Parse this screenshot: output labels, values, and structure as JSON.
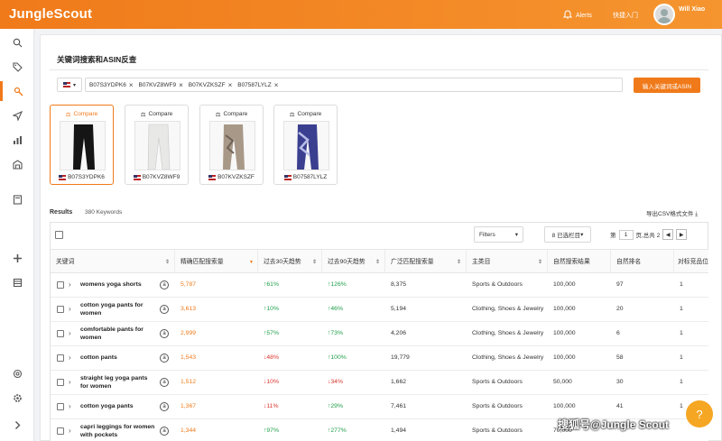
{
  "app": {
    "logo": "JungleScout"
  },
  "header": {
    "alerts": "Alerts",
    "quick_entry": "快捷入门",
    "username": "Will Xiao"
  },
  "section": {
    "title": "关键词搜索和ASIN反查"
  },
  "search": {
    "country": "US",
    "asins": [
      "B07S3YDPK6",
      "B07KVZ8WF9",
      "B07KVZKSZF",
      "B07587LYLZ"
    ],
    "button_label": "输入关键词或ASIN"
  },
  "products": [
    {
      "compare": "Compare",
      "asin": "B07S3YDPK6"
    },
    {
      "compare": "Compare",
      "asin": "B07KVZ8WF9"
    },
    {
      "compare": "Compare",
      "asin": "B07KVZKSZF"
    },
    {
      "compare": "Compare",
      "asin": "B07587LYLZ"
    }
  ],
  "results": {
    "label": "Results",
    "count": "380 Keywords",
    "export": "导出CSV格式文件"
  },
  "toolbar": {
    "filters": "Filters",
    "columns": "8 已选栏目",
    "page_prefix": "第",
    "page_value": "1",
    "page_suffix": "页,总共 2"
  },
  "table": {
    "headers": [
      "关键词",
      "精确匹配搜索量",
      "过去30天趋势",
      "过去90天趋势",
      "广泛匹配搜索量",
      "主类目",
      "自然搜索结果",
      "自然排名",
      "对标竞品位"
    ],
    "rows": [
      {
        "keyword": "womens yoga shorts",
        "exact": "5,787",
        "t30": "61%",
        "t30dir": "up",
        "t90": "126%",
        "t90dir": "up",
        "broad": "8,375",
        "category": "Sports & Outdoors",
        "organic_results": "100,000",
        "organic_rank": "97",
        "competitor": "1"
      },
      {
        "keyword": "cotton yoga pants for women",
        "exact": "3,613",
        "t30": "10%",
        "t30dir": "up",
        "t90": "46%",
        "t90dir": "up",
        "broad": "5,194",
        "category": "Clothing, Shoes & Jewelry",
        "organic_results": "100,000",
        "organic_rank": "20",
        "competitor": "1"
      },
      {
        "keyword": "comfortable pants for women",
        "exact": "2,999",
        "t30": "57%",
        "t30dir": "up",
        "t90": "73%",
        "t90dir": "up",
        "broad": "4,206",
        "category": "Clothing, Shoes & Jewelry",
        "organic_results": "100,000",
        "organic_rank": "6",
        "competitor": "1"
      },
      {
        "keyword": "cotton pants",
        "exact": "1,543",
        "t30": "48%",
        "t30dir": "down",
        "t90": "100%",
        "t90dir": "up",
        "broad": "19,779",
        "category": "Clothing, Shoes & Jewelry",
        "organic_results": "100,000",
        "organic_rank": "58",
        "competitor": "1"
      },
      {
        "keyword": "straight leg yoga pants for women",
        "exact": "1,512",
        "t30": "10%",
        "t30dir": "down",
        "t90": "34%",
        "t90dir": "down",
        "broad": "1,662",
        "category": "Sports & Outdoors",
        "organic_results": "50,000",
        "organic_rank": "30",
        "competitor": "1"
      },
      {
        "keyword": "cotton yoga pants",
        "exact": "1,367",
        "t30": "11%",
        "t30dir": "down",
        "t90": "29%",
        "t90dir": "up",
        "broad": "7,461",
        "category": "Sports & Outdoors",
        "organic_results": "100,000",
        "organic_rank": "41",
        "competitor": "1"
      },
      {
        "keyword": "capri leggings for women with pockets",
        "exact": "1,344",
        "t30": "97%",
        "t30dir": "up",
        "t90": "277%",
        "t90dir": "up",
        "broad": "1,494",
        "category": "Sports & Outdoors",
        "organic_results": "70,000",
        "organic_rank": "",
        "competitor": ""
      }
    ]
  },
  "watermark": "搜狐号@Jungle Scout",
  "colors": {
    "brand": "#f07a1a",
    "up": "#1e9e4a",
    "down": "#d9342b"
  }
}
